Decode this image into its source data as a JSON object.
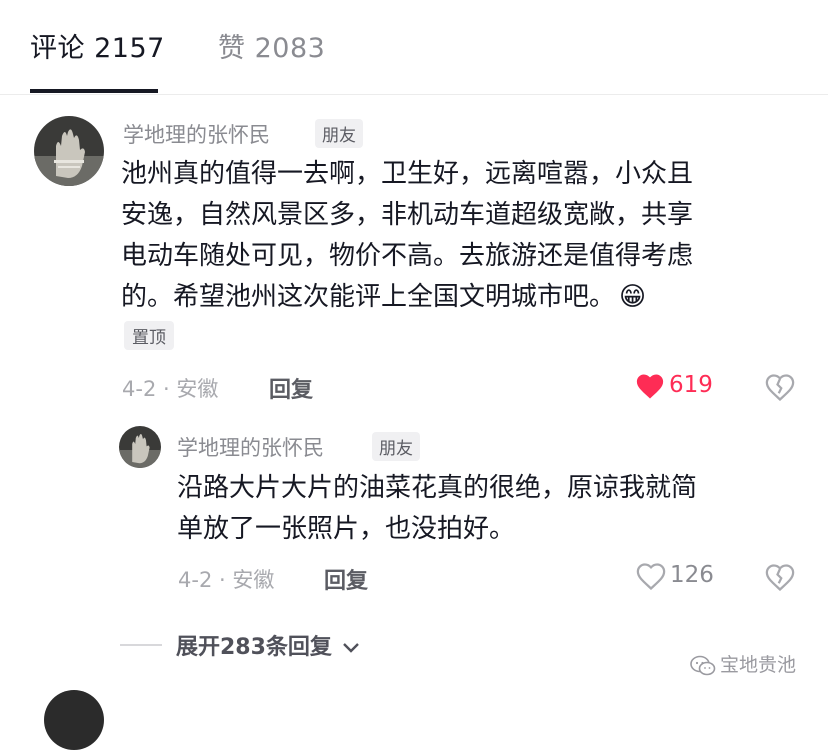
{
  "tabs": [
    {
      "label": "评论 2157",
      "active": true
    },
    {
      "label": "赞 2083",
      "active": false
    }
  ],
  "comments": [
    {
      "username": "学地理的张怀民",
      "badge": "朋友",
      "lines": [
        "池州真的值得一去啊，卫生好，远离喧嚣，小众且",
        "安逸，自然风景区多，非机动车道超级宽敞，共享",
        "电动车随处可见，物价不高。去旅游还是值得考虑",
        "的。希望池州这次能评上全国文明城市吧。"
      ],
      "emoji": "😁",
      "pin_label": "置顶",
      "meta": "4-2 · 安徽",
      "reply_label": "回复",
      "like_count": "619",
      "liked": true
    },
    {
      "username": "学地理的张怀民",
      "badge": "朋友",
      "lines": [
        "沿路大片大片的油菜花真的很绝，原谅我就简",
        "单放了一张照片，也没拍好。"
      ],
      "meta": "4-2 · 安徽",
      "reply_label": "回复",
      "like_count": "126",
      "liked": false
    }
  ],
  "expand_label": "展开283条回复",
  "watermark": "宝地贵池",
  "colors": {
    "like_red": "#fe2c55",
    "text": "#161823",
    "muted": "#8a8b91"
  },
  "icons": [
    "heart-icon",
    "broken-heart-icon",
    "chevron-down-icon",
    "wechat-icon"
  ]
}
